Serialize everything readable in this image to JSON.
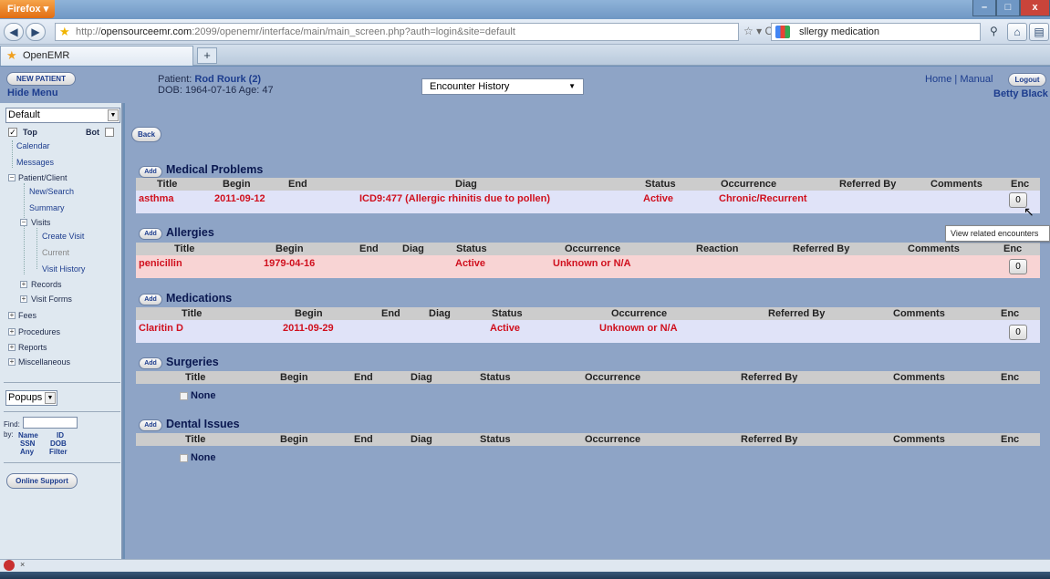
{
  "browser": {
    "app_button": "Firefox",
    "url_host": "opensourceemr.com",
    "url_prefix": "http://",
    "url_rest": ":2099/openemr/interface/main/main_screen.php?auth=login&site=default",
    "search_text": "sllergy medication",
    "tab_title": "OpenEMR",
    "new_tab": "+",
    "back_icon": "back-arrow-icon",
    "forward_icon": "forward-arrow-icon",
    "star_icon": "star-icon",
    "home_icon": "home-icon",
    "window_controls": [
      "–",
      "□",
      "x"
    ]
  },
  "header": {
    "new_patient": "NEW PATIENT",
    "hide_menu": "Hide Menu",
    "patient_label": "Patient:",
    "patient_name": "Rod Rourk (2)",
    "dob_line": "DOB: 1964-07-16 Age: 47",
    "encounter_select": "Encounter History",
    "home": "Home",
    "separator": "|",
    "manual": "Manual",
    "logout": "Logout",
    "user": "Betty Black"
  },
  "sidebar": {
    "default_select": "Default",
    "top": "Top",
    "bot": "Bot",
    "calendar": "Calendar",
    "messages": "Messages",
    "patient_client": "Patient/Client",
    "new_search": "New/Search",
    "summary": "Summary",
    "visits": "Visits",
    "create_visit": "Create Visit",
    "current": "Current",
    "visit_history": "Visit History",
    "records": "Records",
    "visit_forms": "Visit Forms",
    "fees": "Fees",
    "procedures": "Procedures",
    "reports": "Reports",
    "miscellaneous": "Miscellaneous",
    "popups": "Popups",
    "find": "Find:",
    "by": "by:",
    "name": "Name",
    "id": "ID",
    "ssn": "SSN",
    "dob": "DOB",
    "any": "Any",
    "filter": "Filter",
    "online_support": "Online Support"
  },
  "main": {
    "back": "Back",
    "add": "Add",
    "none": "None",
    "tooltip": "View related encounters",
    "medical_problems": {
      "title": "Medical Problems",
      "headers": [
        "Title",
        "Begin",
        "End",
        "Diag",
        "Status",
        "Occurrence",
        "Referred By",
        "Comments",
        "Enc"
      ],
      "row": {
        "title": "asthma",
        "begin": "2011-09-12",
        "end": "",
        "diag": "ICD9:477 (Allergic rhinitis due to pollen)",
        "status": "Active",
        "occurrence": "Chronic/Recurrent",
        "enc": "0"
      }
    },
    "allergies": {
      "title": "Allergies",
      "headers": [
        "Title",
        "Begin",
        "End",
        "Diag",
        "Status",
        "Occurrence",
        "Reaction",
        "Referred By",
        "Comments",
        "Enc"
      ],
      "row": {
        "title": "penicillin",
        "begin": "1979-04-16",
        "status": "Active",
        "occurrence": "Unknown or N/A",
        "enc": "0"
      }
    },
    "medications": {
      "title": "Medications",
      "headers": [
        "Title",
        "Begin",
        "End",
        "Diag",
        "Status",
        "Occurrence",
        "Referred By",
        "Comments",
        "Enc"
      ],
      "row": {
        "title": "Claritin D",
        "begin": "2011-09-29",
        "status": "Active",
        "occurrence": "Unknown or N/A",
        "enc": "0"
      }
    },
    "surgeries": {
      "title": "Surgeries",
      "headers": [
        "Title",
        "Begin",
        "End",
        "Diag",
        "Status",
        "Occurrence",
        "Referred By",
        "Comments",
        "Enc"
      ]
    },
    "dental": {
      "title": "Dental Issues",
      "headers": [
        "Title",
        "Begin",
        "End",
        "Diag",
        "Status",
        "Occurrence",
        "Referred By",
        "Comments",
        "Enc"
      ]
    }
  },
  "colors": {
    "panel_bg": "#8ea4c6",
    "sidebar_bg": "#dfe8f0",
    "header_row": "#cccccc",
    "problem_row": "#e0e3f8",
    "allergy_row": "#f8d4d4",
    "value_red": "#d0101e",
    "link_blue": "#1d3d8e"
  }
}
